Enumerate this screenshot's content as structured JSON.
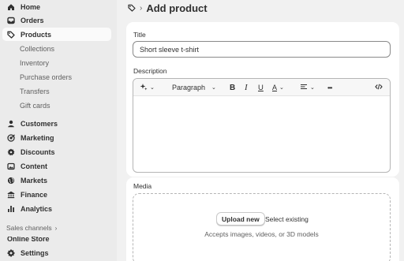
{
  "sidebar": {
    "items": [
      {
        "label": "Home",
        "icon": "home-icon"
      },
      {
        "label": "Orders",
        "icon": "inbox-icon"
      },
      {
        "label": "Products",
        "icon": "tag-icon",
        "active": true
      },
      {
        "label": "Customers",
        "icon": "person-icon"
      },
      {
        "label": "Marketing",
        "icon": "target-icon"
      },
      {
        "label": "Discounts",
        "icon": "discount-gear-icon"
      },
      {
        "label": "Content",
        "icon": "image-icon"
      },
      {
        "label": "Markets",
        "icon": "globe-icon"
      },
      {
        "label": "Finance",
        "icon": "bank-icon"
      },
      {
        "label": "Analytics",
        "icon": "bar-chart-icon"
      }
    ],
    "product_subitems": [
      "Collections",
      "Inventory",
      "Purchase orders",
      "Transfers",
      "Gift cards"
    ],
    "sales_channels_label": "Sales channels",
    "sales_channels_partial": "Online Store",
    "settings_label": "Settings"
  },
  "header": {
    "title": "Add product"
  },
  "form": {
    "title_label": "Title",
    "title_value": "Short sleeve t-shirt",
    "description_label": "Description",
    "toolbar": {
      "paragraph_label": "Paragraph",
      "bold": "B",
      "italic": "I",
      "underline": "U",
      "text_color": "A",
      "more": "•••"
    }
  },
  "media": {
    "label": "Media",
    "upload_button": "Upload new",
    "select_existing": "Select existing",
    "accepts_text": "Accepts images, videos, or 3D models"
  },
  "colors": {
    "sidebar_bg": "#ebebeb",
    "page_bg": "#f1f1f1",
    "card_bg": "#ffffff",
    "text": "#303030",
    "subtle_text": "#616161"
  }
}
